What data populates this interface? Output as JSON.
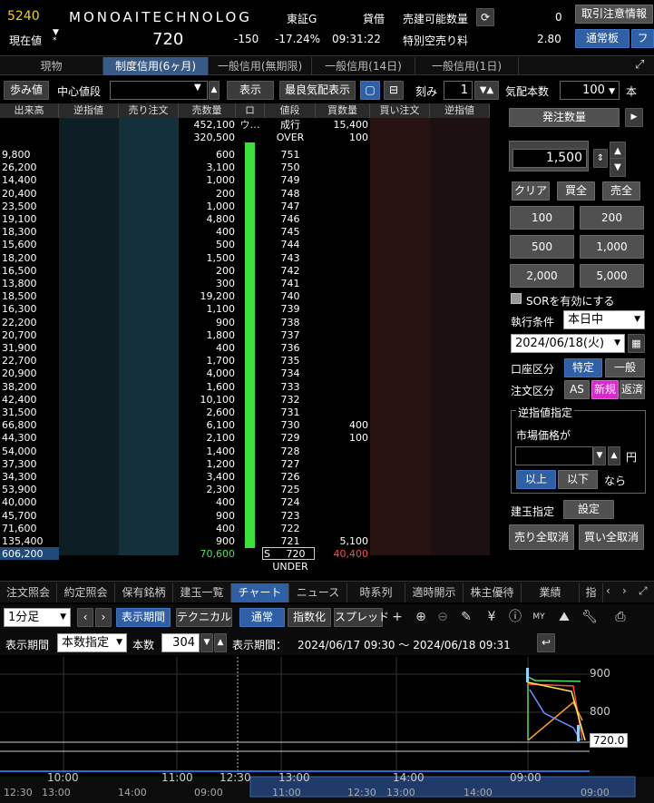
{
  "header": {
    "code": "5240",
    "name": "MONOAITECHNOLOG",
    "market": "東証G",
    "lending": "貸借",
    "sellable_label": "売建可能数量",
    "sellable_value": "0",
    "price_label": "現在値",
    "price": "720",
    "change": "-150",
    "change_pct": "-17.24%",
    "time": "09:31:22",
    "short_fee_label": "特別空売り料",
    "short_fee": "2.80",
    "btn_caution": "取引注意情報",
    "btn_normal": "通常板",
    "btn_f": "フ"
  },
  "tabs": [
    "現物",
    "制度信用(6ヶ月)",
    "一般信用(無期限)",
    "一般信用(14日)",
    "一般信用(1日)"
  ],
  "toolbar": {
    "ayumi": "歩み値",
    "center_label": "中心値段",
    "center_value": "",
    "show": "表示",
    "best": "最良気配表示",
    "tick_label": "刻み",
    "tick_value": "1",
    "qty_label": "気配本数",
    "qty_value": "100",
    "qty_unit": "本"
  },
  "book": {
    "headers": [
      "出来高",
      "逆指値",
      "売り注文",
      "売数量",
      "ロウ…",
      "値段",
      "買数量",
      "買い注文",
      "逆指値"
    ],
    "top": [
      {
        "sell": "452,100",
        "price": "成行",
        "buy": "15,400"
      },
      {
        "sell": "320,500",
        "price": "OVER",
        "buy": "100"
      }
    ],
    "rows": [
      [
        "9,800",
        "600",
        "751",
        ""
      ],
      [
        "26,200",
        "3,100",
        "750",
        ""
      ],
      [
        "14,400",
        "1,000",
        "749",
        ""
      ],
      [
        "20,400",
        "200",
        "748",
        ""
      ],
      [
        "23,500",
        "1,000",
        "747",
        ""
      ],
      [
        "19,100",
        "4,800",
        "746",
        ""
      ],
      [
        "18,300",
        "400",
        "745",
        ""
      ],
      [
        "15,600",
        "500",
        "744",
        ""
      ],
      [
        "18,200",
        "1,500",
        "743",
        ""
      ],
      [
        "16,500",
        "200",
        "742",
        ""
      ],
      [
        "13,800",
        "300",
        "741",
        ""
      ],
      [
        "18,500",
        "19,200",
        "740",
        ""
      ],
      [
        "16,300",
        "1,100",
        "739",
        ""
      ],
      [
        "22,200",
        "900",
        "738",
        ""
      ],
      [
        "20,700",
        "1,800",
        "737",
        ""
      ],
      [
        "31,900",
        "400",
        "736",
        ""
      ],
      [
        "22,700",
        "1,700",
        "735",
        ""
      ],
      [
        "20,900",
        "4,000",
        "734",
        ""
      ],
      [
        "38,200",
        "1,600",
        "733",
        ""
      ],
      [
        "42,400",
        "10,100",
        "732",
        ""
      ],
      [
        "31,500",
        "2,600",
        "731",
        ""
      ],
      [
        "66,800",
        "6,100",
        "730",
        "400"
      ],
      [
        "44,300",
        "2,100",
        "729",
        "100"
      ],
      [
        "54,000",
        "1,400",
        "728",
        ""
      ],
      [
        "37,300",
        "1,200",
        "727",
        ""
      ],
      [
        "34,300",
        "3,400",
        "726",
        ""
      ],
      [
        "53,900",
        "2,300",
        "725",
        ""
      ],
      [
        "40,000",
        "400",
        "724",
        ""
      ],
      [
        "45,700",
        "900",
        "723",
        ""
      ],
      [
        "71,600",
        "400",
        "722",
        ""
      ],
      [
        "135,400",
        "900",
        "721",
        "5,100"
      ]
    ],
    "last": {
      "vol": "606,200",
      "sell": "70,600",
      "mark": "S",
      "price": "720",
      "buy": "40,400"
    },
    "under": "UNDER"
  },
  "right": {
    "order_qty": "発注数量",
    "qty": "1,500",
    "clear": "クリア",
    "buy_all": "買全",
    "sell_all": "売全",
    "q": [
      "100",
      "200",
      "500",
      "1,000",
      "2,000",
      "5,000"
    ],
    "sor": "SORを有効にする",
    "exec_label": "執行条件",
    "exec_value": "本日中",
    "date": "2024/06/18(火)",
    "acct_label": "口座区分",
    "acct1": "特定",
    "acct2": "一般",
    "ord_label": "注文区分",
    "as": "AS",
    "new": "新規",
    "ret": "返済",
    "stop_title": "逆指値指定",
    "market_price": "市場価格が",
    "yen": "円",
    "above": "以上",
    "below": "以下",
    "nara": "なら",
    "pos_label": "建玉指定",
    "pos_set": "設定",
    "cancel_sell": "売り全取消",
    "cancel_buy": "買い全取消"
  },
  "bottom_tabs": [
    "注文照会",
    "約定照会",
    "保有銘柄",
    "建玉一覧",
    "チャート",
    "ニュース",
    "時系列",
    "適時開示",
    "株主優待",
    "業績",
    "指"
  ],
  "chart": {
    "interval": "1分足",
    "period_btn": "表示期間",
    "tech": "テクニカル",
    "normal": "通常",
    "index": "指数化",
    "spread": "スプレッド",
    "period_label": "表示期間",
    "count_mode": "本数指定",
    "count_label": "本数",
    "count": "304",
    "range_label": "表示期間：",
    "range": "2024/06/17 09:30 ～ 2024/06/18 09:31",
    "y_labels": [
      "900",
      "800"
    ],
    "price_tag": "720.0",
    "x_labels": [
      "10:00",
      "11:00",
      "12:30",
      "13:00",
      "14:00",
      "09:00"
    ],
    "x2_labels": [
      "12:30",
      "13:00",
      "14:00",
      "09:00",
      "11:00",
      "12:30",
      "13:00",
      "14:00",
      "09:00"
    ]
  }
}
